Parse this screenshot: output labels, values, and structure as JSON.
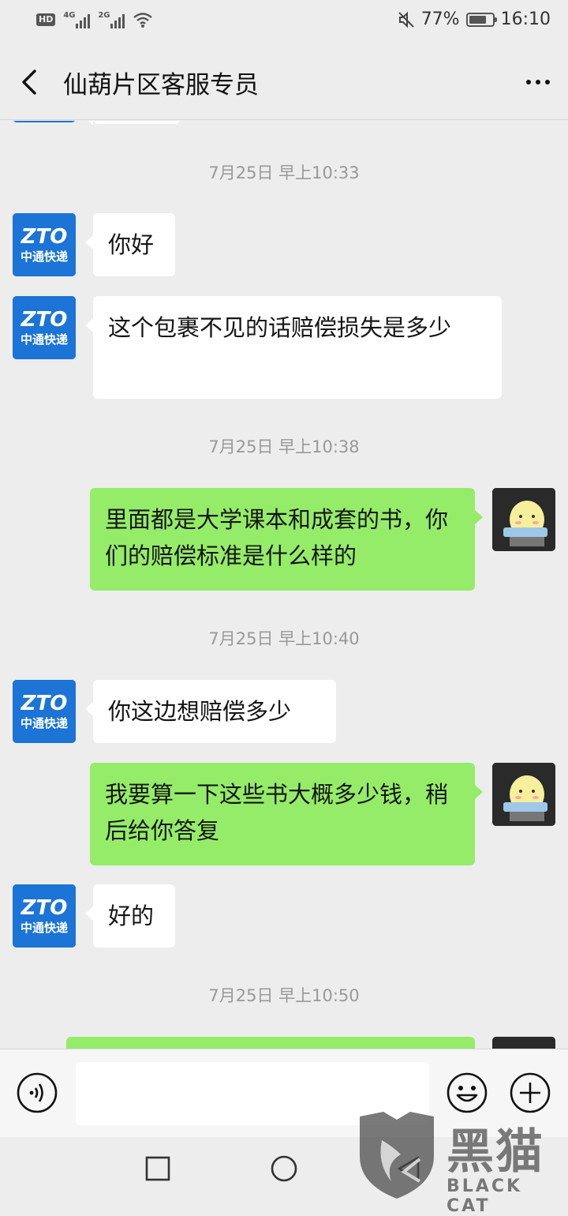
{
  "status_bar": {
    "hd_label": "HD",
    "signal1_label": "4G",
    "signal2_label": "2G",
    "battery_percent": "77%",
    "battery_level": 0.77,
    "time": "16:10"
  },
  "header": {
    "title": "仙葫片区客服专员"
  },
  "messages": [
    {
      "type": "timestamp",
      "text": "7月25日 早上10:33"
    },
    {
      "type": "incoming",
      "sender": "zto",
      "text": "你好"
    },
    {
      "type": "incoming",
      "sender": "zto",
      "text": "这个包裹不见的话赔偿损失是多少"
    },
    {
      "type": "timestamp",
      "text": "7月25日 早上10:38"
    },
    {
      "type": "outgoing",
      "sender": "me",
      "text": "里面都是大学课本和成套的书，你们的赔偿标准是什么样的"
    },
    {
      "type": "timestamp",
      "text": "7月25日 早上10:40"
    },
    {
      "type": "incoming",
      "sender": "zto",
      "text": "你这边想赔偿多少"
    },
    {
      "type": "outgoing",
      "sender": "me",
      "text": "我要算一下这些书大概多少钱，稍后给你答复"
    },
    {
      "type": "incoming",
      "sender": "zto",
      "text": "好的"
    },
    {
      "type": "timestamp",
      "text": "7月25日 早上10:50"
    }
  ],
  "zto_avatar": {
    "logo_text": "ZTO",
    "brand_text": "中通快递"
  },
  "input_bar": {
    "text_value": "",
    "voice_icon": "voice-icon",
    "emoji_icon": "emoji-icon",
    "plus_icon": "plus-icon"
  },
  "nav_bar": {
    "back_icon": "nav-back-icon",
    "home_icon": "nav-home-icon",
    "recents_icon": "nav-recents-icon"
  },
  "watermark": {
    "title": "黑猫",
    "subtitle": "BLACK CAT"
  },
  "colors": {
    "background": "#ededed",
    "outgoing_bubble": "#95ec69",
    "incoming_bubble": "#ffffff",
    "zto_blue": "#1b74d6"
  }
}
